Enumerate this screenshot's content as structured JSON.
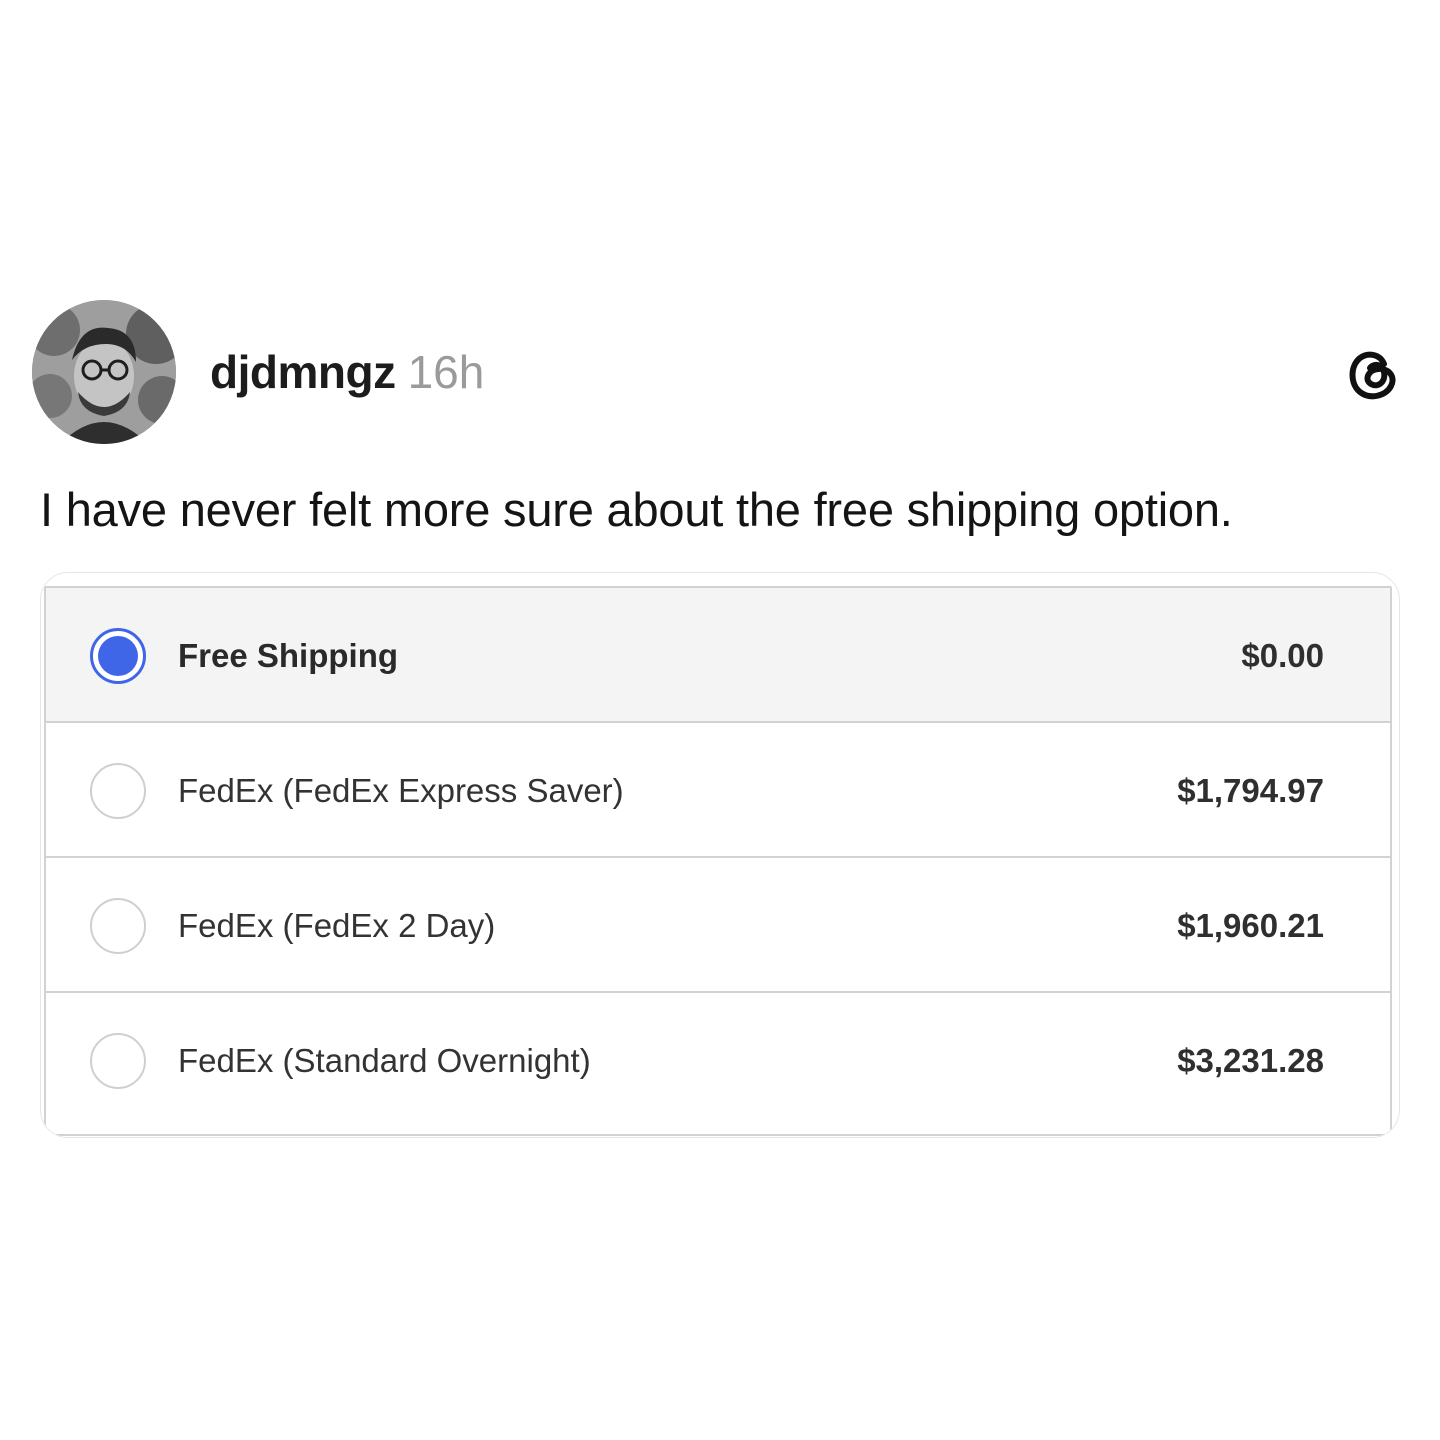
{
  "post": {
    "username": "djdmngz",
    "timestamp": "16h",
    "text": "I have never felt more sure about the free shipping option."
  },
  "icons": {
    "avatar": "user-avatar-photo",
    "brand": "threads-logo-icon"
  },
  "shipping_options": [
    {
      "label": "Free Shipping",
      "price": "$0.00",
      "selected": true
    },
    {
      "label": "FedEx (FedEx Express Saver)",
      "price": "$1,794.97",
      "selected": false
    },
    {
      "label": "FedEx (FedEx 2 Day)",
      "price": "$1,960.21",
      "selected": false
    },
    {
      "label": "FedEx (Standard Overnight)",
      "price": "$3,231.28",
      "selected": false
    }
  ],
  "colors": {
    "accent": "#3f66e6",
    "selected_row": "#f4f4f4",
    "border": "#d2d2d2",
    "muted_text": "#9a9a9a"
  }
}
